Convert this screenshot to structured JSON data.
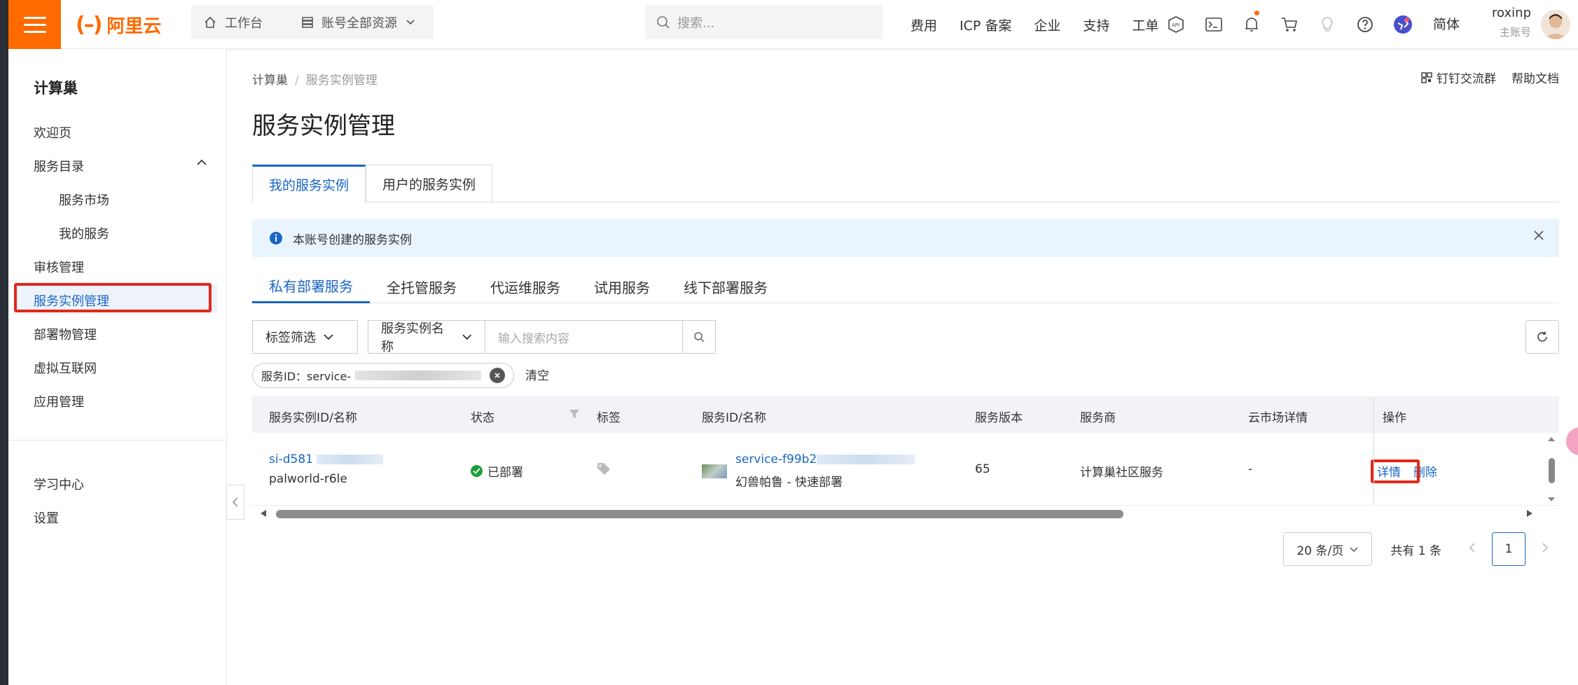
{
  "brand": {
    "logo_text": "阿里云",
    "accent": "#ff6a00"
  },
  "topbar": {
    "workbench": "工作台",
    "resources": "账号全部资源",
    "search_placeholder": "搜索...",
    "links": [
      "费用",
      "ICP 备案",
      "企业",
      "支持",
      "工单"
    ],
    "icons": [
      "api-icon",
      "terminal-icon",
      "bell-icon",
      "cart-icon",
      "bulb-icon",
      "help-icon",
      "globe-icon"
    ],
    "language": "简体",
    "user_name": "roxinp",
    "user_role": "主账号"
  },
  "sidebar": {
    "title": "计算巢",
    "items": [
      {
        "label": "欢迎页"
      },
      {
        "label": "服务目录"
      },
      {
        "label": "服务市场"
      },
      {
        "label": "我的服务"
      },
      {
        "label": "审核管理"
      },
      {
        "label": "服务实例管理"
      },
      {
        "label": "部署物管理"
      },
      {
        "label": "虚拟互联网"
      },
      {
        "label": "应用管理"
      },
      {
        "label": "学习中心"
      },
      {
        "label": "设置"
      }
    ]
  },
  "breadcrumb": {
    "root": "计算巢",
    "current": "服务实例管理"
  },
  "header_links": {
    "dingtalk": "钉钉交流群",
    "docs": "帮助文档"
  },
  "page_title": "服务实例管理",
  "tabs": [
    "我的服务实例",
    "用户的服务实例"
  ],
  "alert": "本账号创建的服务实例",
  "subtabs": [
    "私有部署服务",
    "全托管服务",
    "代运维服务",
    "试用服务",
    "线下部署服务"
  ],
  "filter": {
    "tag_filter": "标签筛选",
    "field": "服务实例名称",
    "input_placeholder": "输入搜索内容"
  },
  "chip": {
    "label": "服务ID：service-"
  },
  "clear": "清空",
  "table": {
    "columns": [
      "服务实例ID/名称",
      "状态",
      "标签",
      "服务ID/名称",
      "服务版本",
      "服务商",
      "云市场详情",
      "操作"
    ],
    "rows": [
      {
        "instance_id": "si-d581",
        "instance_name": "palworld-r6le",
        "status": "已部署",
        "service_id": "service-f99b2",
        "service_name": "幻兽帕鲁 - 快速部署",
        "version": "65",
        "provider": "计算巢社区服务",
        "market": "-",
        "actions": [
          "详情",
          "删除"
        ]
      }
    ]
  },
  "pagination": {
    "page_size": "20 条/页",
    "total": "共有 1 条",
    "current": "1"
  }
}
